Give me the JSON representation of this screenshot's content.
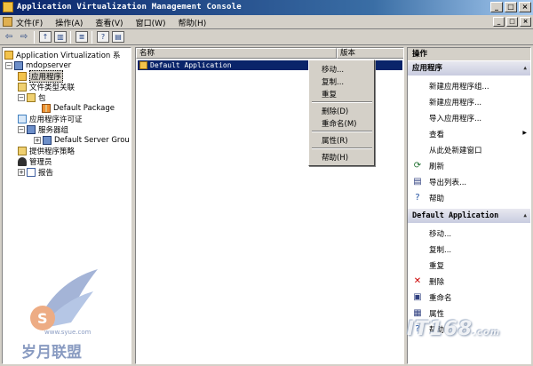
{
  "window": {
    "title": "Application Virtualization Management Console",
    "controls": [
      "_",
      "□",
      "×"
    ]
  },
  "menubar": {
    "items": [
      "文件(F)",
      "操作(A)",
      "查看(V)",
      "窗口(W)",
      "帮助(H)"
    ],
    "controls": [
      "_",
      "□",
      "×"
    ]
  },
  "toolbar": {
    "back": "⇦",
    "forward": "⇨"
  },
  "tree": {
    "root": "Application Virtualization 系",
    "server": "mdopserver",
    "items": [
      "应用程序",
      "文件类型关联",
      "包",
      "Default Package",
      "应用程序许可证",
      "服务器组",
      "Default Server Grou",
      "提供程序策略",
      "管理员",
      "报告"
    ]
  },
  "list": {
    "columns": [
      "名称",
      "版本"
    ],
    "rows": [
      "Default Application"
    ]
  },
  "context_menu": {
    "items": [
      "移动...",
      "复制...",
      "重复",
      "删除(D)",
      "重命名(M)",
      "属性(R)",
      "帮助(H)"
    ]
  },
  "actions": {
    "header": "操作",
    "section1": "应用程序",
    "section1_items": [
      "新建应用程序组...",
      "新建应用程序...",
      "导入应用程序...",
      "查看",
      "从此处新建窗口",
      "刷新",
      "导出列表...",
      "帮助"
    ],
    "section2": "Default Application",
    "section2_items": [
      "移动...",
      "复制...",
      "重复",
      "删除",
      "重命名",
      "属性",
      "帮助"
    ]
  },
  "watermarks": {
    "left_brand": "岁月联盟",
    "left_url": "www.syue.com",
    "right_brand": "IT168",
    "right_suffix": ".com"
  },
  "colors": {
    "title_bar": "#0a246a",
    "selection": "#0a246a",
    "delete_icon": "#cc0000"
  }
}
